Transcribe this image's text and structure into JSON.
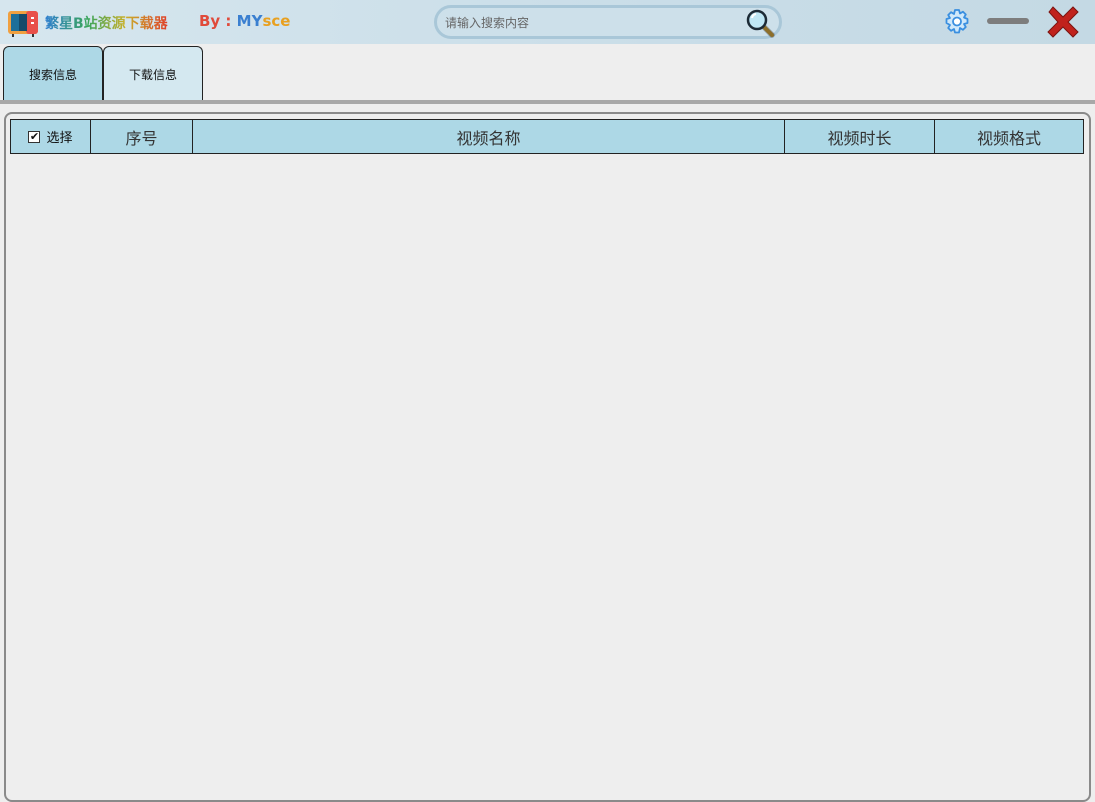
{
  "app": {
    "title": "繁星B站资源下载器",
    "author_prefix": "By : ",
    "author_a": "MY",
    "author_b": "sce",
    "logo_icon": "tv-icon"
  },
  "search": {
    "placeholder": "请输入搜索内容",
    "icon": "magnifier-icon"
  },
  "window_controls": {
    "settings_icon": "gear-icon",
    "minimize_icon": "minimize-icon",
    "close_icon": "close-icon"
  },
  "tabs": [
    {
      "label": "搜索信息",
      "active": true
    },
    {
      "label": "下载信息",
      "active": false
    }
  ],
  "table": {
    "select_label": "选择",
    "select_checked": true,
    "columns": [
      "序号",
      "视频名称",
      "视频时长",
      "视频格式"
    ],
    "rows": []
  },
  "colors": {
    "header_bg": "#add8e6",
    "accent_blue": "#3a8fe0",
    "close_red": "#c0221c"
  }
}
